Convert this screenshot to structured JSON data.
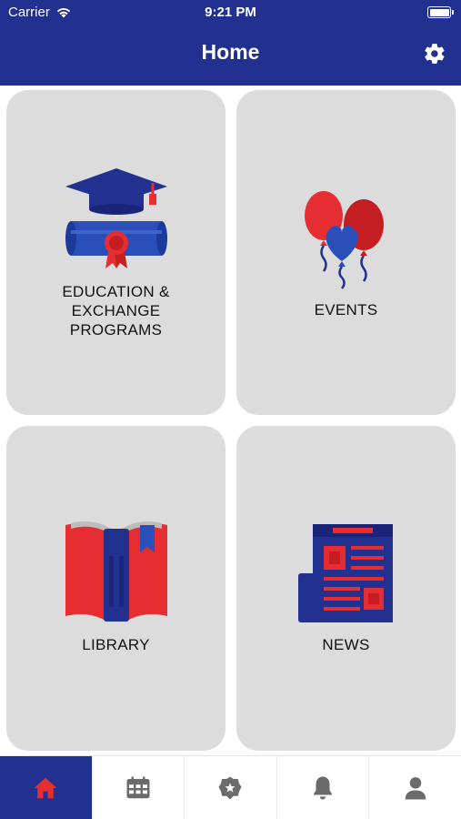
{
  "status_bar": {
    "carrier": "Carrier",
    "time": "9:21 PM"
  },
  "header": {
    "title": "Home",
    "settings_icon": "gear-icon"
  },
  "tiles": [
    {
      "label": "EDUCATION &\nEXCHANGE\nPROGRAMS",
      "icon": "graduation-cap-diploma-icon"
    },
    {
      "label": "EVENTS",
      "icon": "balloons-icon"
    },
    {
      "label": "LIBRARY",
      "icon": "open-book-icon"
    },
    {
      "label": "NEWS",
      "icon": "newspaper-icon"
    }
  ],
  "tab_bar": {
    "active_index": 0,
    "tabs": [
      {
        "icon": "home-icon"
      },
      {
        "icon": "calendar-icon"
      },
      {
        "icon": "badge-icon"
      },
      {
        "icon": "bell-icon"
      },
      {
        "icon": "user-icon"
      }
    ]
  },
  "colors": {
    "brand_blue": "#22308f",
    "accent_red": "#e62e32",
    "tile_bg": "#dcdcdc",
    "tab_icon_gray": "#6b6b6b"
  }
}
